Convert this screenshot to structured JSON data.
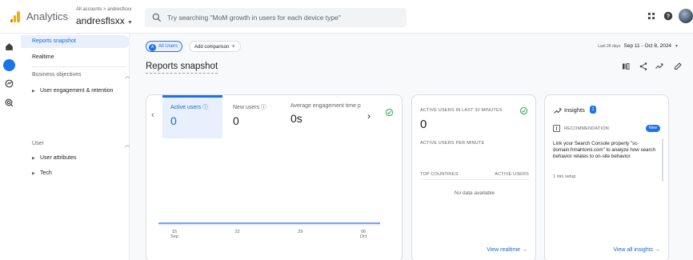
{
  "header": {
    "app_name": "Analytics",
    "account_path": "All accounts > andresflsxx",
    "account_name": "andresflsxx",
    "search_placeholder": "Try searching \"MoM growth in users for each device type\""
  },
  "sidenav": {
    "reports_snapshot": "Reports snapshot",
    "realtime": "Realtime",
    "business_objectives": "Business objectives",
    "user_engagement": "User engagement & retention",
    "user": "User",
    "user_attributes": "User attributes",
    "tech": "Tech"
  },
  "toolbar": {
    "all_users": "All Users",
    "add_comparison": "Add comparison",
    "date_label": "Last 28 days",
    "date_range": "Sep 11 - Oct 8, 2024"
  },
  "page": {
    "title": "Reports snapshot"
  },
  "metrics": {
    "active_users_label": "Active users",
    "active_users_value": "0",
    "new_users_label": "New users",
    "new_users_value": "0",
    "avg_engagement_label": "Average engagement time p",
    "avg_engagement_value": "0s"
  },
  "chart_data": {
    "type": "line",
    "x": [
      "15 Sep",
      "22",
      "29",
      "06 Oct"
    ],
    "tick_labels": [
      [
        "15",
        "Sep"
      ],
      [
        "22",
        ""
      ],
      [
        "29",
        ""
      ],
      [
        "06",
        "Oct"
      ]
    ],
    "series": [
      {
        "values": [
          0,
          0,
          0,
          0
        ],
        "color": "#4285f4"
      }
    ]
  },
  "realtime": {
    "title": "ACTIVE USERS IN LAST 30 MINUTES",
    "value": "0",
    "per_minute": "ACTIVE USERS PER MINUTE",
    "top_countries": "TOP COUNTRIES",
    "active_users_col": "ACTIVE USERS",
    "no_data": "No data available",
    "view_realtime": "View realtime →"
  },
  "insights": {
    "title": "Insights",
    "badge_count": "1",
    "recommendation": "RECOMMENDATION",
    "new_badge": "New",
    "text": "Link your Search Console property \"sc-domain:hmahtomi.com\" to analyze how search behavior relates to on-site behavior",
    "time": "1 min setup",
    "view_all": "View all insights →"
  },
  "colors": {
    "accent": "#1a73e8",
    "success": "#34a853",
    "logo_orange": "#f9ab00"
  }
}
